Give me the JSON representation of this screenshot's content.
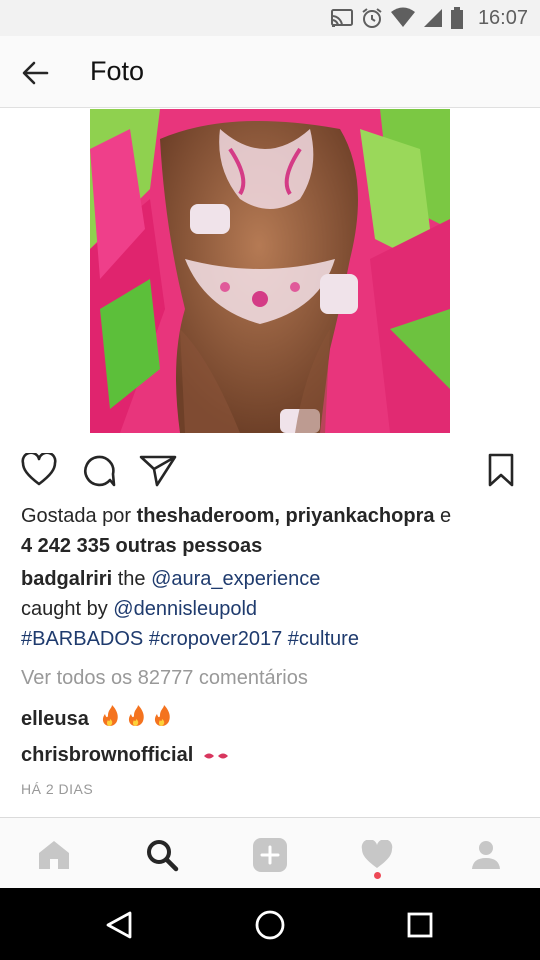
{
  "status_bar": {
    "time": "16:07",
    "icons": [
      "cast-icon",
      "alarm-icon",
      "wifi-icon",
      "signal-icon",
      "battery-icon"
    ]
  },
  "header": {
    "title": "Foto",
    "back_icon": "arrow-left-icon"
  },
  "post": {
    "image_description_icon": "photo",
    "actions": [
      "heart-icon",
      "comment-icon",
      "share-icon",
      "bookmark-icon"
    ],
    "likes": {
      "prefix": "Gostada por ",
      "users": "theshaderoom, priyankachopra",
      "joiner": " e",
      "count_text": "4 242 335 outras pessoas"
    },
    "caption": {
      "username": "badgalriri",
      "text1": " the ",
      "mention1": "@aura_experience",
      "line2_text": "caught by ",
      "mention2": "@dennisleupold",
      "hashtags": "#BARBADOS #cropover2017 #culture"
    },
    "view_comments": "Ver todos os 82777 comentários",
    "comments": [
      {
        "username": "elleusa",
        "emoji": "fire-emoji x3"
      },
      {
        "username": "chrisbrownofficial",
        "emoji": "lips-emoji"
      }
    ],
    "timestamp": "HÁ 2 DIAS"
  },
  "bottom_nav": {
    "items": [
      "home-icon",
      "search-icon",
      "add-icon",
      "activity-heart-icon",
      "profile-icon"
    ],
    "active": "search-icon",
    "notification_color": "#ed4956"
  },
  "system_nav": {
    "buttons": [
      "back-triangle-icon",
      "home-circle-icon",
      "recents-square-icon"
    ]
  },
  "colors": {
    "link": "#1f3b6e",
    "muted": "#999999",
    "text": "#262626"
  }
}
